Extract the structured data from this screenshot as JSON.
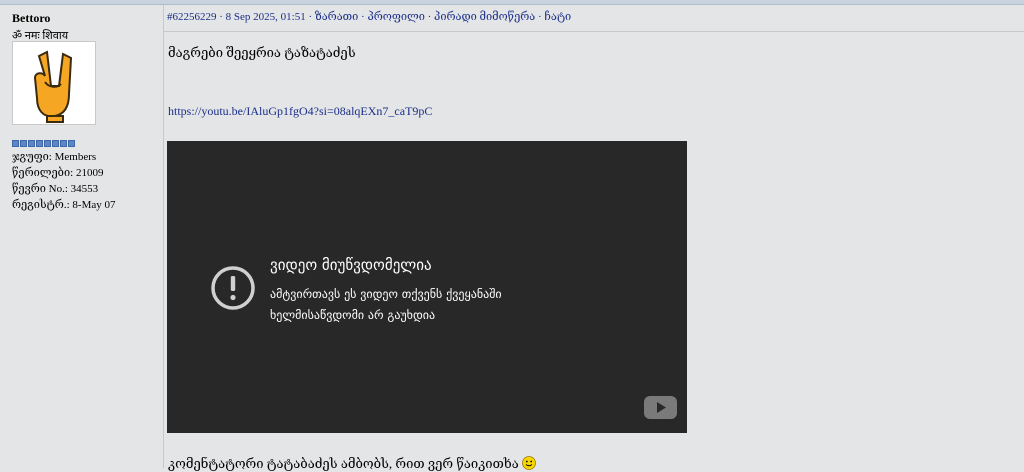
{
  "sidebar": {
    "username": "Bettoro",
    "custom_title": "ॐ नमः शिवाय",
    "rank_pips": 8,
    "stats": [
      {
        "label": "ჯგუფი:",
        "value": "Members"
      },
      {
        "label": "წერილები:",
        "value": "21009"
      },
      {
        "label": "წევრი No.:",
        "value": "34553"
      },
      {
        "label": "რეგისტრ.:",
        "value": "8-May 07"
      }
    ]
  },
  "post": {
    "id": "#62256229",
    "datetime": "· 8 Sep 2025, 01:51 ·",
    "actions": [
      "ზარათი",
      "პროფილი",
      "პირადი მიმოწერა",
      "ჩატი"
    ],
    "text": "მაგრები შეეყრია ტაზატაძეს",
    "link": "https://youtu.be/IAluGp1fgO4?si=08alqEXn7_caT9pC",
    "video": {
      "title": "ვიდეო მიუწვდომელია",
      "message": "ამტვირთავს ეს ვიდეო თქვენს ქვეყანაში ხელმისაწვდომი არ გაუხდია"
    },
    "footer_text": "კომენტატორი ტატაბაძეს ამბობს, რით ვერ წაიკითხა"
  },
  "colors": {
    "link": "#1a2e8a",
    "page_bg": "#e4e5e6",
    "video_bg": "#282828",
    "rank_pip": "#5c86c7"
  }
}
